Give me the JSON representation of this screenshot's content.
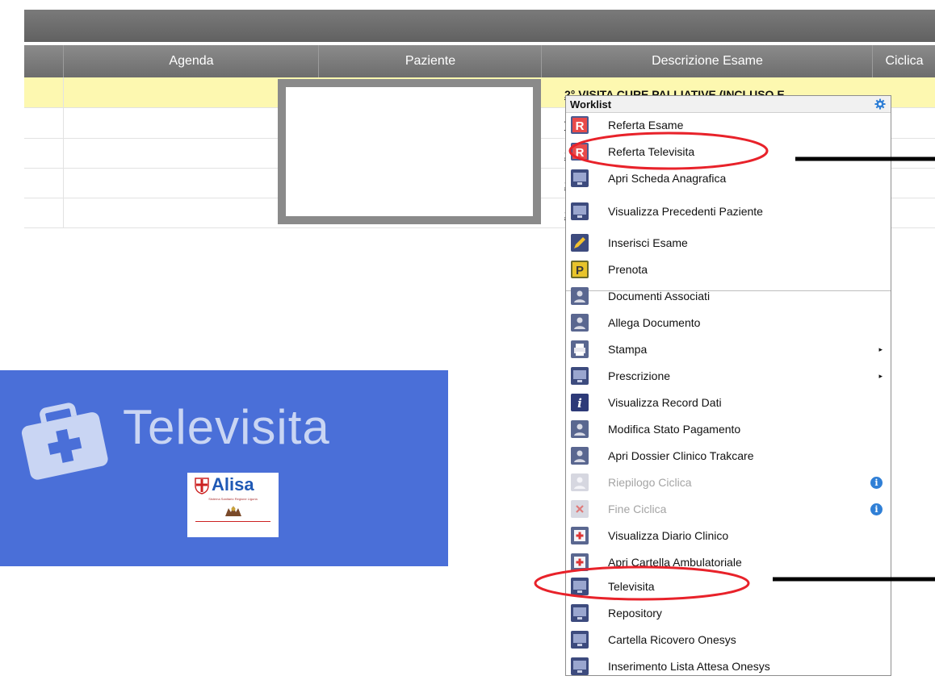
{
  "table": {
    "headers": [
      "Agenda",
      "Paziente",
      "Descrizione Esame",
      "Ciclica"
    ],
    "rows": [
      {
        "descrizione": "2° VISITA CURE PALLIATIVE (INCLUSO E",
        "highlighted": true
      },
      {
        "descrizione": "VIS",
        "highlighted": false
      },
      {
        "descrizione": "2°",
        "highlighted": false
      },
      {
        "descrizione": "2° '",
        "highlighted": false
      },
      {
        "descrizione": "2° '",
        "highlighted": false
      }
    ],
    "highlight_color": "#fdf8b0"
  },
  "menu": {
    "title": "Worklist",
    "items": [
      {
        "label": "Referta Esame",
        "icon": "referta-r-icon",
        "enabled": true
      },
      {
        "label": "Referta Televisita",
        "icon": "referta-r-icon",
        "enabled": true,
        "circled": true
      },
      {
        "label": "Apri Scheda Anagrafica",
        "icon": "monitor-icon",
        "enabled": true
      },
      {
        "label": "Visualizza Precedenti Paziente",
        "icon": "monitor-icon",
        "enabled": true
      },
      {
        "label": "Inserisci Esame",
        "icon": "pencil-icon",
        "enabled": true
      },
      {
        "label": "Prenota",
        "icon": "p-booking-icon",
        "enabled": true
      },
      {
        "label": "Documenti Associati",
        "icon": "person-card-icon",
        "enabled": true
      },
      {
        "label": "Allega Documento",
        "icon": "person-card-icon",
        "enabled": true
      },
      {
        "label": "Stampa",
        "icon": "printer-icon",
        "enabled": true,
        "submenu": true
      },
      {
        "label": "Prescrizione",
        "icon": "monitor-icon",
        "enabled": true,
        "submenu": true
      },
      {
        "label": "Visualizza Record Dati",
        "icon": "info-i-icon",
        "enabled": true
      },
      {
        "label": "Modifica Stato Pagamento",
        "icon": "person-card-icon",
        "enabled": true
      },
      {
        "label": "Apri Dossier Clinico Trakcare",
        "icon": "person-card-icon",
        "enabled": true
      },
      {
        "label": "Riepilogo Ciclica",
        "icon": "person-card-icon",
        "enabled": false,
        "info": true
      },
      {
        "label": "Fine Ciclica",
        "icon": "close-x-icon",
        "enabled": false,
        "info": true
      },
      {
        "label": "Visualizza Diario Clinico",
        "icon": "medical-folder-icon",
        "enabled": true
      },
      {
        "label": "Apri Cartella Ambulatoriale",
        "icon": "medical-folder-icon",
        "enabled": true
      },
      {
        "label": "Televisita",
        "icon": "monitor-icon",
        "enabled": true,
        "circled": true
      },
      {
        "label": "Repository",
        "icon": "monitor-icon",
        "enabled": true
      },
      {
        "label": "Cartella Ricovero Onesys",
        "icon": "monitor-icon",
        "enabled": true
      },
      {
        "label": "Inserimento Lista Attesa Onesys",
        "icon": "monitor-icon",
        "enabled": true
      }
    ],
    "submenu_arrow": "▸",
    "info_glyph": "i"
  },
  "banner": {
    "title": "Televisita",
    "icon": "medical-kit-icon",
    "background": "#4a6fd8",
    "logo": {
      "name": "Alisa",
      "subtitle": "Sistema Sanitario Regione Liguria"
    }
  },
  "annotations": {
    "circle_color": "#e8222a",
    "arrow_color": "#000000"
  }
}
